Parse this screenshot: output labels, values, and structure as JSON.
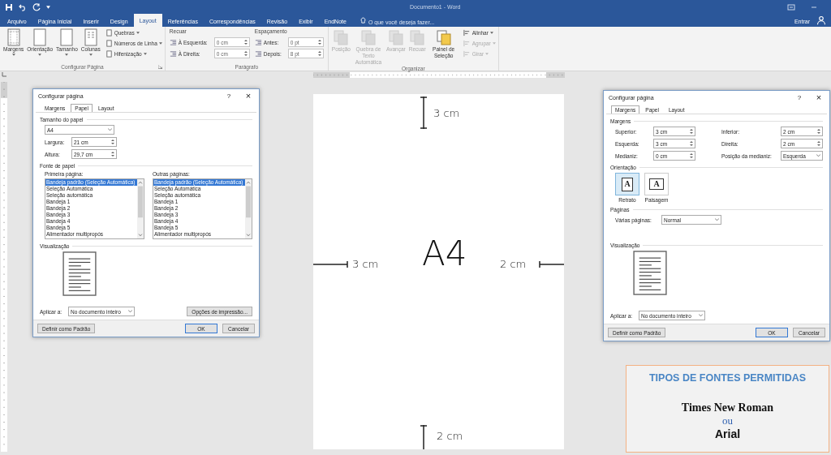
{
  "window": {
    "title": "Documento1 - Word"
  },
  "ribbon_tabs": [
    {
      "label": "Arquivo",
      "selected": false
    },
    {
      "label": "Página Inicial",
      "selected": false
    },
    {
      "label": "Inserir",
      "selected": false
    },
    {
      "label": "Design",
      "selected": false
    },
    {
      "label": "Layout",
      "selected": true
    },
    {
      "label": "Referências",
      "selected": false
    },
    {
      "label": "Correspondências",
      "selected": false
    },
    {
      "label": "Revisão",
      "selected": false
    },
    {
      "label": "Exibir",
      "selected": false
    },
    {
      "label": "EndNote",
      "selected": false
    }
  ],
  "tell_me": {
    "placeholder": "O que você deseja fazer..."
  },
  "account": {
    "label": "Entrar"
  },
  "ribbon": {
    "page_setup": {
      "label": "Configurar Página",
      "large_buttons": [
        {
          "label": "Margens"
        },
        {
          "label": "Orientação"
        },
        {
          "label": "Tamanho"
        },
        {
          "label": "Colunas"
        }
      ],
      "small_buttons": [
        {
          "label": "Quebras"
        },
        {
          "label": "Números de Linha"
        },
        {
          "label": "Hifenização"
        }
      ]
    },
    "paragraph": {
      "label": "Parágrafo",
      "columns": [
        {
          "heading": "Recuar",
          "fields": [
            {
              "label": "À Esquerda:",
              "value": "0 cm"
            },
            {
              "label": "À Direita:",
              "value": "0 cm"
            }
          ]
        },
        {
          "heading": "Espaçamento",
          "fields": [
            {
              "label": "Antes:",
              "value": "0 pt"
            },
            {
              "label": "Depois:",
              "value": "8 pt"
            }
          ]
        }
      ]
    },
    "arrange": {
      "label": "Organizar",
      "large_buttons": [
        {
          "label": "Posição",
          "disabled": true
        },
        {
          "label": "Quebra de Texto Automática",
          "disabled": true
        },
        {
          "label": "Avançar",
          "disabled": true
        },
        {
          "label": "Recuar",
          "disabled": true
        },
        {
          "label": "Painel de Seleção",
          "disabled": false
        }
      ],
      "small_buttons": [
        {
          "label": "Alinhar",
          "disabled": false
        },
        {
          "label": "Agrupar",
          "disabled": true
        },
        {
          "label": "Girar",
          "disabled": true
        }
      ]
    }
  },
  "page": {
    "title": "A4",
    "top": "3 cm",
    "left": "3 cm",
    "right": "2 cm",
    "bottom": "2 cm"
  },
  "dialogs": [
    {
      "kind": "paper",
      "title": "Configurar página",
      "help": "?",
      "close": "×",
      "tabs": [
        {
          "label": "Margens",
          "selected": false
        },
        {
          "label": "Papel",
          "selected": true
        },
        {
          "label": "Layout",
          "selected": false
        }
      ],
      "paper_size": {
        "heading": "Tamanho do papel",
        "size": "A4",
        "fields": [
          {
            "label": "Largura:",
            "value": "21 cm"
          },
          {
            "label": "Altura:",
            "value": "29,7 cm"
          }
        ]
      },
      "paper_source": {
        "heading": "Fonte de papel",
        "lists": [
          {
            "label": "Primeira página:",
            "items": [
              {
                "label": "Bandeja padrão (Seleção Automática)",
                "selected": true
              },
              {
                "label": "Seleção Automática",
                "selected": false
              },
              {
                "label": "Seleção automática",
                "selected": false
              },
              {
                "label": "Bandeja 1",
                "selected": false
              },
              {
                "label": "Bandeja 2",
                "selected": false
              },
              {
                "label": "Bandeja 3",
                "selected": false
              },
              {
                "label": "Bandeja 4",
                "selected": false
              },
              {
                "label": "Bandeja 5",
                "selected": false
              },
              {
                "label": "Alimentador multipropós",
                "selected": false
              }
            ]
          },
          {
            "label": "Outras páginas:",
            "items": [
              {
                "label": "Bandeja padrão (Seleção Automática)",
                "selected": true
              },
              {
                "label": "Seleção Automática",
                "selected": false
              },
              {
                "label": "Seleção automática",
                "selected": false
              },
              {
                "label": "Bandeja 1",
                "selected": false
              },
              {
                "label": "Bandeja 2",
                "selected": false
              },
              {
                "label": "Bandeja 3",
                "selected": false
              },
              {
                "label": "Bandeja 4",
                "selected": false
              },
              {
                "label": "Bandeja 5",
                "selected": false
              },
              {
                "label": "Alimentador multipropós",
                "selected": false
              }
            ]
          }
        ]
      },
      "preview_label": "Visualização",
      "apply_label": "Aplicar a:",
      "apply_value": "No documento inteiro",
      "print_options": "Opções de impressão...",
      "buttons": [
        {
          "label": "Definir como Padrão",
          "kind": "default"
        },
        {
          "label": "OK",
          "kind": "primary"
        },
        {
          "label": "Cancelar",
          "kind": "cancel"
        }
      ]
    },
    {
      "kind": "margins",
      "title": "Configurar página",
      "help": "?",
      "close": "×",
      "tabs": [
        {
          "label": "Margens",
          "selected": true
        },
        {
          "label": "Papel",
          "selected": false
        },
        {
          "label": "Layout",
          "selected": false
        }
      ],
      "margins": {
        "heading": "Margens",
        "fields": [
          {
            "label": "Superior:",
            "value": "3 cm"
          },
          {
            "label": "Inferior:",
            "value": "2 cm"
          },
          {
            "label": "Esquerda:",
            "value": "3 cm"
          },
          {
            "label": "Direita:",
            "value": "2 cm"
          },
          {
            "label": "Medianiz:",
            "value": "0 cm"
          },
          {
            "label": "Posição da medianiz:",
            "value": "Esquerda",
            "kind": "select"
          }
        ]
      },
      "orientation": {
        "heading": "Orientação",
        "options": [
          {
            "label": "Retrato",
            "glyph": "A",
            "selected": true
          },
          {
            "label": "Paisagem",
            "glyph": "A",
            "selected": false
          }
        ]
      },
      "pages": {
        "heading": "Páginas",
        "label": "Várias páginas:",
        "value": "Normal"
      },
      "preview_label": "Visualização",
      "apply_label": "Aplicar a:",
      "apply_value": "No documento inteiro",
      "buttons": [
        {
          "label": "Definir como Padrão",
          "kind": "default"
        },
        {
          "label": "OK",
          "kind": "primary"
        },
        {
          "label": "Cancelar",
          "kind": "cancel"
        }
      ]
    }
  ],
  "note": {
    "title": "TIPOS DE FONTES PERMITIDAS",
    "option_1": "Times New Roman",
    "separator": "ou",
    "option_2": "Arial"
  }
}
